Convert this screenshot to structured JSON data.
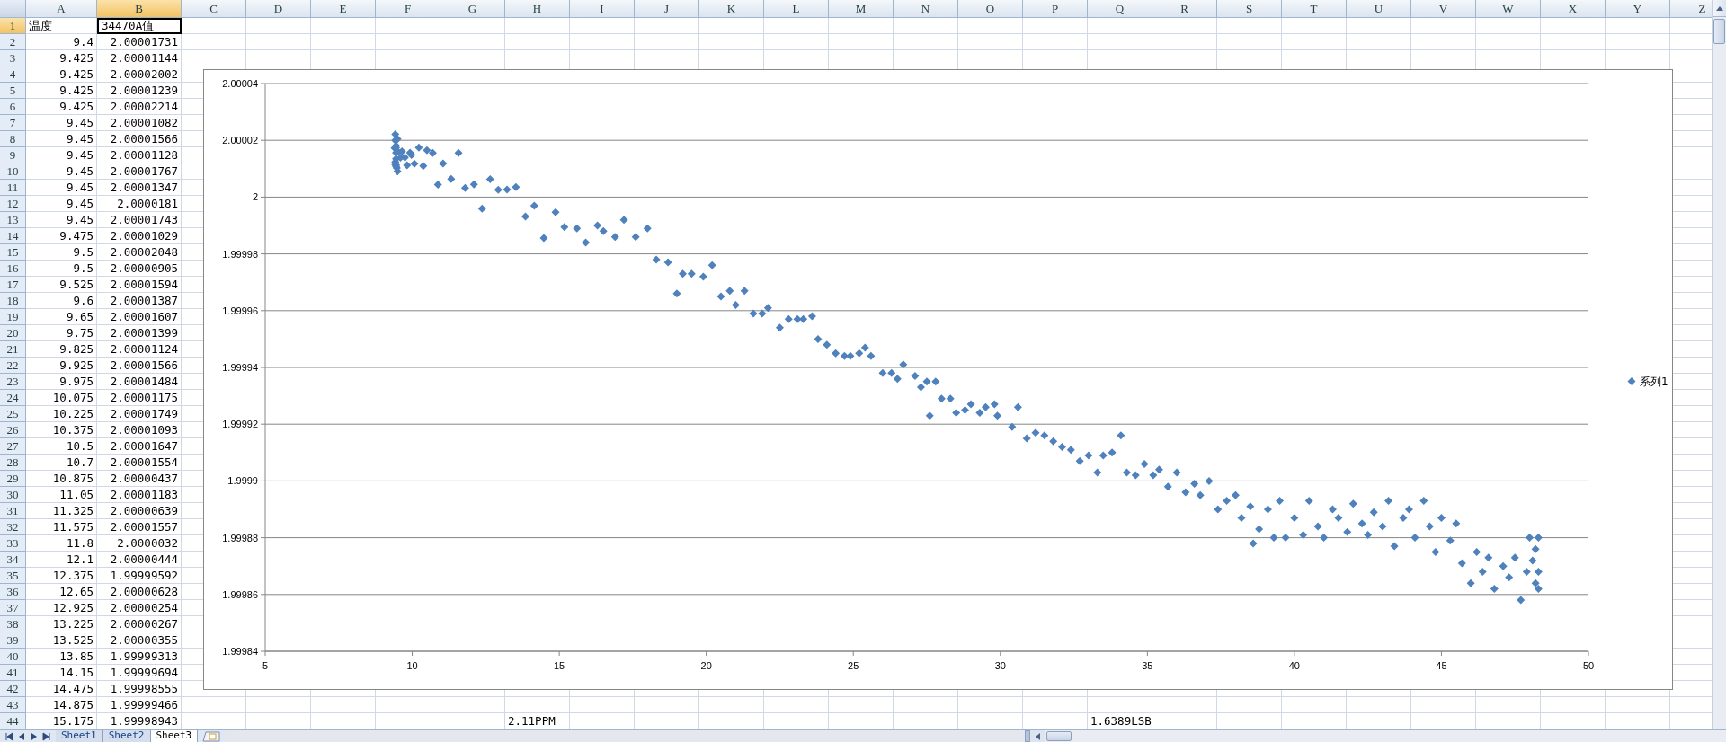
{
  "columns": [
    {
      "label": "A",
      "selected": false
    },
    {
      "label": "B",
      "selected": true
    },
    {
      "label": "C",
      "selected": false
    },
    {
      "label": "D",
      "selected": false
    },
    {
      "label": "E",
      "selected": false
    },
    {
      "label": "F",
      "selected": false
    },
    {
      "label": "G",
      "selected": false
    },
    {
      "label": "H",
      "selected": false
    },
    {
      "label": "I",
      "selected": false
    },
    {
      "label": "J",
      "selected": false
    },
    {
      "label": "K",
      "selected": false
    },
    {
      "label": "L",
      "selected": false
    },
    {
      "label": "M",
      "selected": false
    },
    {
      "label": "N",
      "selected": false
    },
    {
      "label": "O",
      "selected": false
    },
    {
      "label": "P",
      "selected": false
    },
    {
      "label": "Q",
      "selected": false
    },
    {
      "label": "R",
      "selected": false
    },
    {
      "label": "S",
      "selected": false
    },
    {
      "label": "T",
      "selected": false
    },
    {
      "label": "U",
      "selected": false
    },
    {
      "label": "V",
      "selected": false
    },
    {
      "label": "W",
      "selected": false
    },
    {
      "label": "X",
      "selected": false
    },
    {
      "label": "Y",
      "selected": false
    },
    {
      "label": "Z",
      "selected": false
    }
  ],
  "rows": [
    {
      "number": "1",
      "selected": true,
      "kind": "text",
      "a": "温度",
      "b": "34470A值"
    },
    {
      "number": "2",
      "selected": false,
      "kind": "number",
      "a": "9.4",
      "b": "2.00001731"
    },
    {
      "number": "3",
      "selected": false,
      "kind": "number",
      "a": "9.425",
      "b": "2.00001144"
    },
    {
      "number": "4",
      "selected": false,
      "kind": "number",
      "a": "9.425",
      "b": "2.00002002"
    },
    {
      "number": "5",
      "selected": false,
      "kind": "number",
      "a": "9.425",
      "b": "2.00001239"
    },
    {
      "number": "6",
      "selected": false,
      "kind": "number",
      "a": "9.425",
      "b": "2.00002214"
    },
    {
      "number": "7",
      "selected": false,
      "kind": "number",
      "a": "9.45",
      "b": "2.00001082"
    },
    {
      "number": "8",
      "selected": false,
      "kind": "number",
      "a": "9.45",
      "b": "2.00001566"
    },
    {
      "number": "9",
      "selected": false,
      "kind": "number",
      "a": "9.45",
      "b": "2.00001128"
    },
    {
      "number": "10",
      "selected": false,
      "kind": "number",
      "a": "9.45",
      "b": "2.00001767"
    },
    {
      "number": "11",
      "selected": false,
      "kind": "number",
      "a": "9.45",
      "b": "2.00001347"
    },
    {
      "number": "12",
      "selected": false,
      "kind": "number",
      "a": "9.45",
      "b": "2.0000181"
    },
    {
      "number": "13",
      "selected": false,
      "kind": "number",
      "a": "9.45",
      "b": "2.00001743"
    },
    {
      "number": "14",
      "selected": false,
      "kind": "number",
      "a": "9.475",
      "b": "2.00001029"
    },
    {
      "number": "15",
      "selected": false,
      "kind": "number",
      "a": "9.5",
      "b": "2.00002048"
    },
    {
      "number": "16",
      "selected": false,
      "kind": "number",
      "a": "9.5",
      "b": "2.00000905"
    },
    {
      "number": "17",
      "selected": false,
      "kind": "number",
      "a": "9.525",
      "b": "2.00001594"
    },
    {
      "number": "18",
      "selected": false,
      "kind": "number",
      "a": "9.6",
      "b": "2.00001387"
    },
    {
      "number": "19",
      "selected": false,
      "kind": "number",
      "a": "9.65",
      "b": "2.00001607"
    },
    {
      "number": "20",
      "selected": false,
      "kind": "number",
      "a": "9.75",
      "b": "2.00001399"
    },
    {
      "number": "21",
      "selected": false,
      "kind": "number",
      "a": "9.825",
      "b": "2.00001124"
    },
    {
      "number": "22",
      "selected": false,
      "kind": "number",
      "a": "9.925",
      "b": "2.00001566"
    },
    {
      "number": "23",
      "selected": false,
      "kind": "number",
      "a": "9.975",
      "b": "2.00001484"
    },
    {
      "number": "24",
      "selected": false,
      "kind": "number",
      "a": "10.075",
      "b": "2.00001175"
    },
    {
      "number": "25",
      "selected": false,
      "kind": "number",
      "a": "10.225",
      "b": "2.00001749"
    },
    {
      "number": "26",
      "selected": false,
      "kind": "number",
      "a": "10.375",
      "b": "2.00001093"
    },
    {
      "number": "27",
      "selected": false,
      "kind": "number",
      "a": "10.5",
      "b": "2.00001647"
    },
    {
      "number": "28",
      "selected": false,
      "kind": "number",
      "a": "10.7",
      "b": "2.00001554"
    },
    {
      "number": "29",
      "selected": false,
      "kind": "number",
      "a": "10.875",
      "b": "2.00000437"
    },
    {
      "number": "30",
      "selected": false,
      "kind": "number",
      "a": "11.05",
      "b": "2.00001183"
    },
    {
      "number": "31",
      "selected": false,
      "kind": "number",
      "a": "11.325",
      "b": "2.00000639"
    },
    {
      "number": "32",
      "selected": false,
      "kind": "number",
      "a": "11.575",
      "b": "2.00001557"
    },
    {
      "number": "33",
      "selected": false,
      "kind": "number",
      "a": "11.8",
      "b": "2.0000032"
    },
    {
      "number": "34",
      "selected": false,
      "kind": "number",
      "a": "12.1",
      "b": "2.00000444"
    },
    {
      "number": "35",
      "selected": false,
      "kind": "number",
      "a": "12.375",
      "b": "1.99999592"
    },
    {
      "number": "36",
      "selected": false,
      "kind": "number",
      "a": "12.65",
      "b": "2.00000628"
    },
    {
      "number": "37",
      "selected": false,
      "kind": "number",
      "a": "12.925",
      "b": "2.00000254"
    },
    {
      "number": "38",
      "selected": false,
      "kind": "number",
      "a": "13.225",
      "b": "2.00000267"
    },
    {
      "number": "39",
      "selected": false,
      "kind": "number",
      "a": "13.525",
      "b": "2.00000355"
    },
    {
      "number": "40",
      "selected": false,
      "kind": "number",
      "a": "13.85",
      "b": "1.99999313"
    },
    {
      "number": "41",
      "selected": false,
      "kind": "number",
      "a": "14.15",
      "b": "1.99999694"
    },
    {
      "number": "42",
      "selected": false,
      "kind": "number",
      "a": "14.475",
      "b": "1.99998555"
    },
    {
      "number": "43",
      "selected": false,
      "kind": "number",
      "a": "14.875",
      "b": "1.99999466"
    },
    {
      "number": "44",
      "selected": false,
      "kind": "number",
      "a": "15.175",
      "b": "1.99998943"
    }
  ],
  "row_44_results": [
    "2.11PPM",
    "1.6389LSB"
  ],
  "chart": {
    "chart_data": {
      "type": "scatter",
      "grid": true,
      "xlim": [
        5,
        50
      ],
      "ylim": [
        1.99984,
        2.00004
      ],
      "xticks": [
        5,
        10,
        15,
        20,
        25,
        30,
        35,
        40,
        45,
        50
      ],
      "yticks": [
        {
          "value": 1.99984,
          "label": "1.99984"
        },
        {
          "value": 1.99986,
          "label": "1.99986"
        },
        {
          "value": 1.99988,
          "label": "1.99988"
        },
        {
          "value": 1.9999,
          "label": "1.9999"
        },
        {
          "value": 1.99992,
          "label": "1.99992"
        },
        {
          "value": 1.99994,
          "label": "1.99994"
        },
        {
          "value": 1.99996,
          "label": "1.99996"
        },
        {
          "value": 1.99998,
          "label": "1.99998"
        },
        {
          "value": 2,
          "label": "2"
        },
        {
          "value": 2.00002,
          "label": "2.00002"
        },
        {
          "value": 2.00004,
          "label": "2.00004"
        }
      ],
      "x": [
        9.4,
        9.425,
        9.425,
        9.425,
        9.425,
        9.45,
        9.45,
        9.45,
        9.45,
        9.45,
        9.45,
        9.475,
        9.5,
        9.5,
        9.525,
        9.6,
        9.65,
        9.75,
        9.825,
        9.925,
        9.975,
        10.075,
        10.225,
        10.375,
        10.5,
        10.7,
        10.875,
        11.05,
        11.325,
        11.575,
        11.8,
        12.1,
        12.375,
        12.65,
        12.925,
        13.225,
        13.525,
        13.85,
        14.15,
        14.475,
        14.875,
        15.175,
        15.6,
        15.9,
        16.3,
        16.5,
        16.9,
        17.2,
        17.6,
        18.0,
        18.3,
        18.7,
        19.0,
        19.2,
        19.5,
        19.9,
        20.2,
        20.5,
        20.8,
        21.0,
        21.3,
        21.6,
        21.9,
        22.1,
        22.5,
        22.8,
        23.1,
        23.3,
        23.6,
        23.8,
        24.1,
        24.4,
        24.7,
        24.9,
        25.2,
        25.4,
        25.6,
        26.0,
        26.3,
        26.5,
        26.7,
        27.1,
        27.3,
        27.5,
        27.8,
        27.6,
        28.0,
        28.3,
        28.5,
        28.8,
        29.0,
        29.3,
        29.5,
        29.8,
        29.9,
        30.4,
        30.6,
        30.9,
        31.2,
        31.5,
        31.8,
        32.1,
        32.4,
        32.7,
        33.0,
        33.3,
        33.5,
        33.8,
        34.1,
        34.3,
        34.6,
        34.9,
        35.2,
        35.4,
        35.7,
        36.0,
        36.3,
        36.6,
        36.8,
        37.1,
        37.4,
        37.7,
        38.0,
        38.2,
        38.5,
        38.6,
        38.8,
        39.1,
        39.3,
        39.5,
        39.7,
        40.0,
        40.3,
        40.5,
        40.8,
        41.0,
        41.3,
        41.5,
        41.8,
        42.0,
        42.3,
        42.5,
        42.7,
        43.0,
        43.2,
        43.4,
        43.7,
        43.9,
        44.1,
        44.4,
        44.6,
        44.8,
        45.0,
        45.3,
        45.5,
        45.7,
        46.0,
        46.2,
        46.4,
        46.6,
        46.8,
        47.1,
        47.3,
        47.5,
        47.7,
        47.9,
        48.0,
        48.1,
        48.2,
        48.2,
        48.3,
        48.3,
        48.3
      ],
      "series": [
        {
          "name": "系列1",
          "color": "#4f81bd",
          "values": [
            2.00001731,
            2.00001144,
            2.00002002,
            2.00001239,
            2.00002214,
            2.00001082,
            2.00001566,
            2.00001128,
            2.00001347,
            2.0000181,
            2.00001743,
            2.00001029,
            2.00002048,
            2.00000905,
            2.00001594,
            2.00001387,
            2.00001607,
            2.00001399,
            2.00001124,
            2.00001566,
            2.00001484,
            2.00001175,
            2.00001749,
            2.00001093,
            2.00001647,
            2.00001554,
            2.00000437,
            2.00001183,
            2.00000639,
            2.00001557,
            2.0000032,
            2.00000444,
            1.99999592,
            2.00000628,
            2.00000254,
            2.00000267,
            2.00000355,
            1.99999313,
            1.99999694,
            1.99998555,
            1.99999466,
            1.99998943,
            1.999989,
            1.999984,
            1.99999,
            1.999988,
            1.999986,
            1.999992,
            1.999986,
            1.999989,
            1.999978,
            1.999977,
            1.999966,
            1.999973,
            1.999973,
            1.999972,
            1.999976,
            1.999965,
            1.999967,
            1.999962,
            1.999967,
            1.999959,
            1.999959,
            1.999961,
            1.999954,
            1.999957,
            1.999957,
            1.999957,
            1.999958,
            1.99995,
            1.999948,
            1.999945,
            1.999944,
            1.999944,
            1.999945,
            1.999947,
            1.999944,
            1.999938,
            1.999938,
            1.999936,
            1.999941,
            1.999937,
            1.999933,
            1.999935,
            1.999935,
            1.999923,
            1.999929,
            1.999929,
            1.999924,
            1.999925,
            1.999927,
            1.999924,
            1.999926,
            1.999927,
            1.999923,
            1.999919,
            1.999926,
            1.999915,
            1.999917,
            1.999916,
            1.999914,
            1.999912,
            1.999911,
            1.999907,
            1.999909,
            1.999903,
            1.999909,
            1.99991,
            1.999916,
            1.999903,
            1.999902,
            1.999906,
            1.999902,
            1.999904,
            1.999898,
            1.999903,
            1.999896,
            1.999899,
            1.999895,
            1.9999,
            1.99989,
            1.999893,
            1.999895,
            1.999887,
            1.999891,
            1.999878,
            1.999883,
            1.99989,
            1.99988,
            1.999893,
            1.99988,
            1.999887,
            1.999881,
            1.999893,
            1.999884,
            1.99988,
            1.99989,
            1.999887,
            1.999882,
            1.999892,
            1.999885,
            1.999881,
            1.999889,
            1.999884,
            1.999893,
            1.999877,
            1.999887,
            1.99989,
            1.99988,
            1.999893,
            1.999884,
            1.999875,
            1.999887,
            1.999879,
            1.999885,
            1.999871,
            1.999864,
            1.999875,
            1.999868,
            1.999873,
            1.999862,
            1.99987,
            1.999866,
            1.999873,
            1.999858,
            1.999868,
            1.99988,
            1.999872,
            1.999864,
            1.999876,
            1.999868,
            1.99988,
            1.999862
          ]
        }
      ]
    }
  },
  "sheet_tabs": [
    {
      "label": "Sheet1",
      "selected": false
    },
    {
      "label": "Sheet2",
      "selected": false
    },
    {
      "label": "Sheet3",
      "selected": true
    }
  ]
}
